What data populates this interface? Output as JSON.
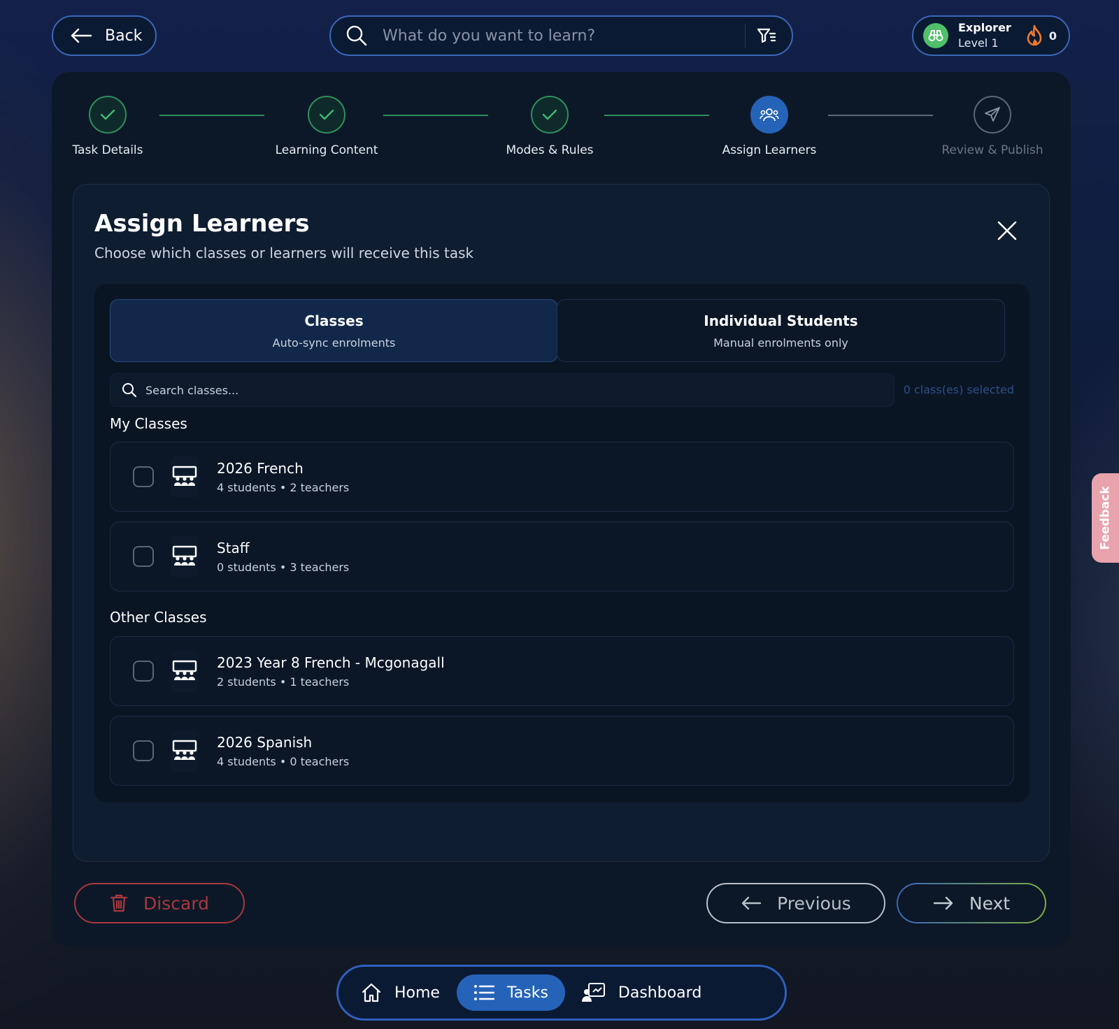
{
  "topbar": {
    "back_label": "Back",
    "search_placeholder": "What do you want to learn?",
    "profile": {
      "name": "Explorer",
      "level": "Level 1",
      "streak": "0"
    }
  },
  "stepper": {
    "steps": [
      {
        "label": "Task Details",
        "state": "done"
      },
      {
        "label": "Learning Content",
        "state": "done"
      },
      {
        "label": "Modes & Rules",
        "state": "done"
      },
      {
        "label": "Assign Learners",
        "state": "active"
      },
      {
        "label": "Review & Publish",
        "state": "pending"
      }
    ]
  },
  "card": {
    "title": "Assign Learners",
    "subtitle": "Choose which classes or learners will receive this task"
  },
  "tabs": [
    {
      "title": "Classes",
      "subtitle": "Auto-sync enrolments",
      "active": true
    },
    {
      "title": "Individual Students",
      "subtitle": "Manual enrolments only",
      "active": false
    }
  ],
  "class_search": {
    "placeholder": "Search classes...",
    "selected_text": "0 class(es) selected"
  },
  "sections": {
    "my_classes": {
      "title": "My Classes",
      "items": [
        {
          "name": "2026 French",
          "meta": "4 students • 2 teachers",
          "checked": false
        },
        {
          "name": "Staff",
          "meta": "0 students • 3 teachers",
          "checked": false
        }
      ]
    },
    "other_classes": {
      "title": "Other Classes",
      "items": [
        {
          "name": "2023 Year 8 French - Mcgonagall",
          "meta": "2 students • 1 teachers",
          "checked": false
        },
        {
          "name": "2026 Spanish",
          "meta": "4 students • 0 teachers",
          "checked": false
        }
      ]
    }
  },
  "footer": {
    "discard_label": "Discard",
    "previous_label": "Previous",
    "next_label": "Next"
  },
  "feedback_label": "Feedback",
  "bottom_nav": {
    "items": [
      {
        "label": "Home",
        "active": false
      },
      {
        "label": "Tasks",
        "active": true
      },
      {
        "label": "Dashboard",
        "active": false
      }
    ]
  },
  "colors": {
    "accent_blue": "#2563b8",
    "done_green": "#2f8f5b",
    "discard_red": "#a8383e",
    "feedback_pink": "#e8a3ad"
  }
}
